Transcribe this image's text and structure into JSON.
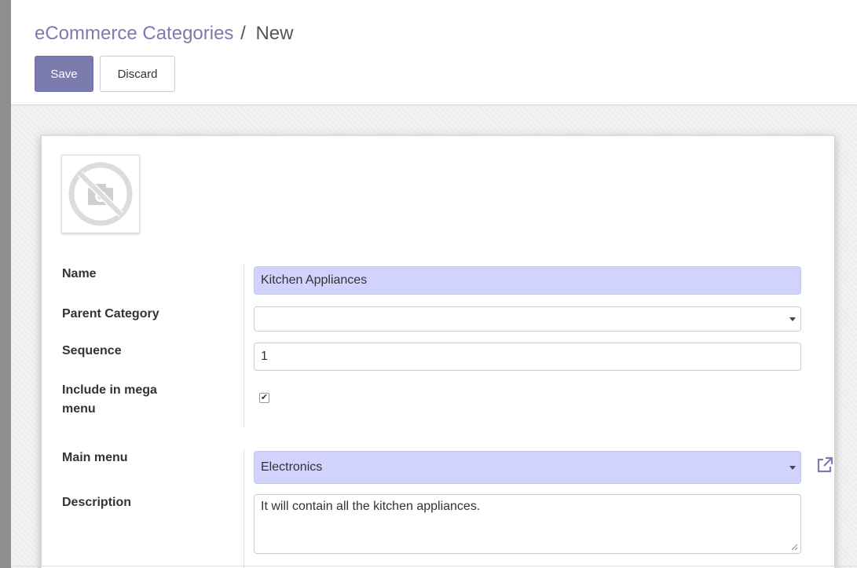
{
  "breadcrumb": {
    "parent": "eCommerce Categories",
    "separator": "/",
    "current": "New"
  },
  "buttons": {
    "save": "Save",
    "discard": "Discard"
  },
  "image": {
    "icon": "no-image-camera-icon"
  },
  "form": {
    "name": {
      "label": "Name",
      "value": "Kitchen Appliances"
    },
    "parent_category": {
      "label": "Parent Category",
      "value": ""
    },
    "sequence": {
      "label": "Sequence",
      "value": "1"
    },
    "include_mega_menu": {
      "label_line1": "Include in mega",
      "label_line2": "menu",
      "checked": true
    },
    "main_menu": {
      "label": "Main menu",
      "value": "Electronics"
    },
    "description": {
      "label": "Description",
      "value": "It will contain all the kitchen appliances."
    }
  },
  "colors": {
    "primary": "#7c7bad",
    "required_field": "#d2d2ff"
  }
}
